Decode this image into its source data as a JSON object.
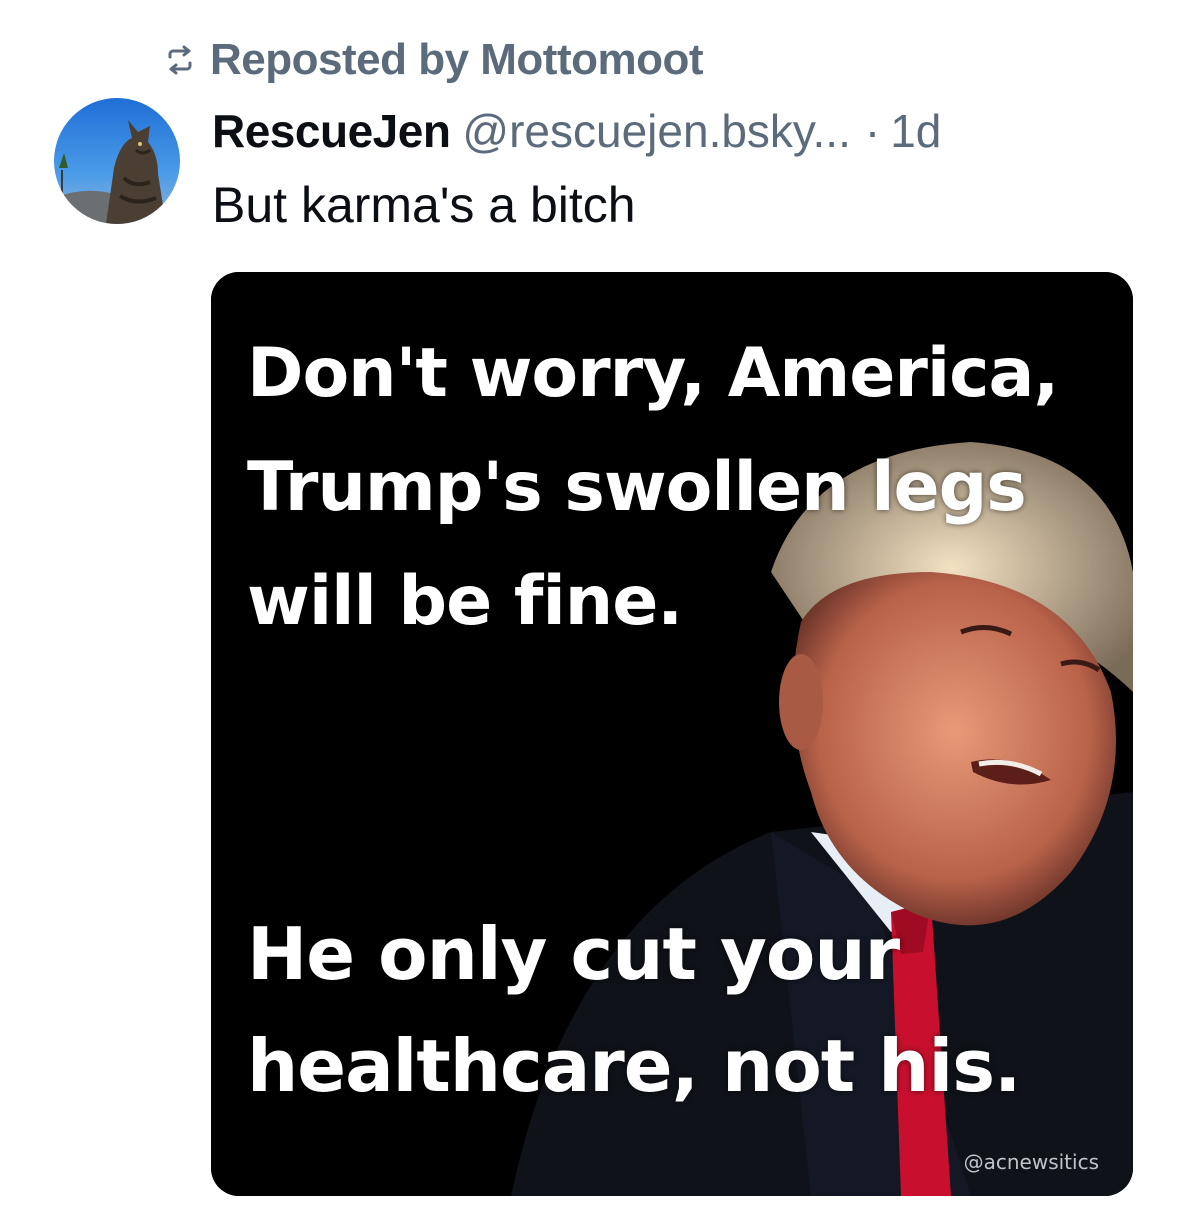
{
  "repost": {
    "icon": "repost-icon",
    "label": "Reposted by Mottomoot"
  },
  "post": {
    "avatar_icon": "cat-avatar",
    "display_name": "RescueJen",
    "handle": "@rescuejen.bsky...",
    "separator": "·",
    "timestamp": "1d",
    "text": "But karma's a bitch"
  },
  "image": {
    "lines": [
      "Don't worry, America,",
      "Trump's swollen legs",
      "will be fine.",
      "He only cut your",
      "healthcare, not his."
    ],
    "watermark": "@acnewsitics"
  },
  "colors": {
    "muted": "#5b6b7c",
    "text": "#0b0f14",
    "image_bg": "#000000"
  }
}
